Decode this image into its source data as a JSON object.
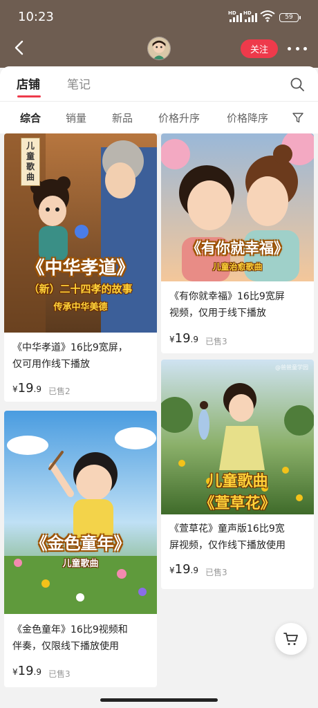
{
  "status_bar": {
    "time": "10:23",
    "battery": "59",
    "network_1": "HD",
    "network_2": "HD"
  },
  "header": {
    "follow_label": "关注"
  },
  "tabs": [
    {
      "label": "店铺"
    },
    {
      "label": "笔记"
    }
  ],
  "sort_options": [
    {
      "label": "综合"
    },
    {
      "label": "销量"
    },
    {
      "label": "新品"
    },
    {
      "label": "价格升序"
    },
    {
      "label": "价格降序"
    }
  ],
  "products": [
    {
      "title_line1": "《中华孝道》16比9宽屏，",
      "title_line2": "仅可用作线下播放",
      "price_currency": "¥",
      "price_int": "19",
      "price_dec": ".9",
      "sold": "已售2",
      "cover_tag": "儿童歌曲",
      "cover_title": "《中华孝道》",
      "cover_sub1": "（新）二十四孝的故事",
      "cover_sub2": "传承中华美德"
    },
    {
      "title_line1": "《有你就幸福》16比9宽屏",
      "title_line2": "视频，仅用于线下播放",
      "price_currency": "¥",
      "price_int": "19",
      "price_dec": ".9",
      "sold": "已售3",
      "cover_title": "《有你就幸福》",
      "cover_sub1": "儿童治愈歌曲"
    },
    {
      "title_line1": "《萱草花》童声版16比9宽",
      "title_line2": "屏视频，仅作线下播放使用",
      "price_currency": "¥",
      "price_int": "19",
      "price_dec": ".9",
      "sold": "已售3",
      "cover_title": "儿童歌曲",
      "cover_sub1": "《萱草花》",
      "watermark": "@爸爸童学园"
    },
    {
      "title_line1": "《金色童年》16比9视频和",
      "title_line2": "伴奏，仅限线下播放使用",
      "price_currency": "¥",
      "price_int": "19",
      "price_dec": ".9",
      "sold": "已售3",
      "cover_title": "《金色童年》",
      "cover_sub1": "儿童歌曲"
    }
  ],
  "colors": {
    "accent": "#ee3a4b",
    "header_bg": "#6e5d51",
    "page_bg": "#f2f2f2"
  }
}
